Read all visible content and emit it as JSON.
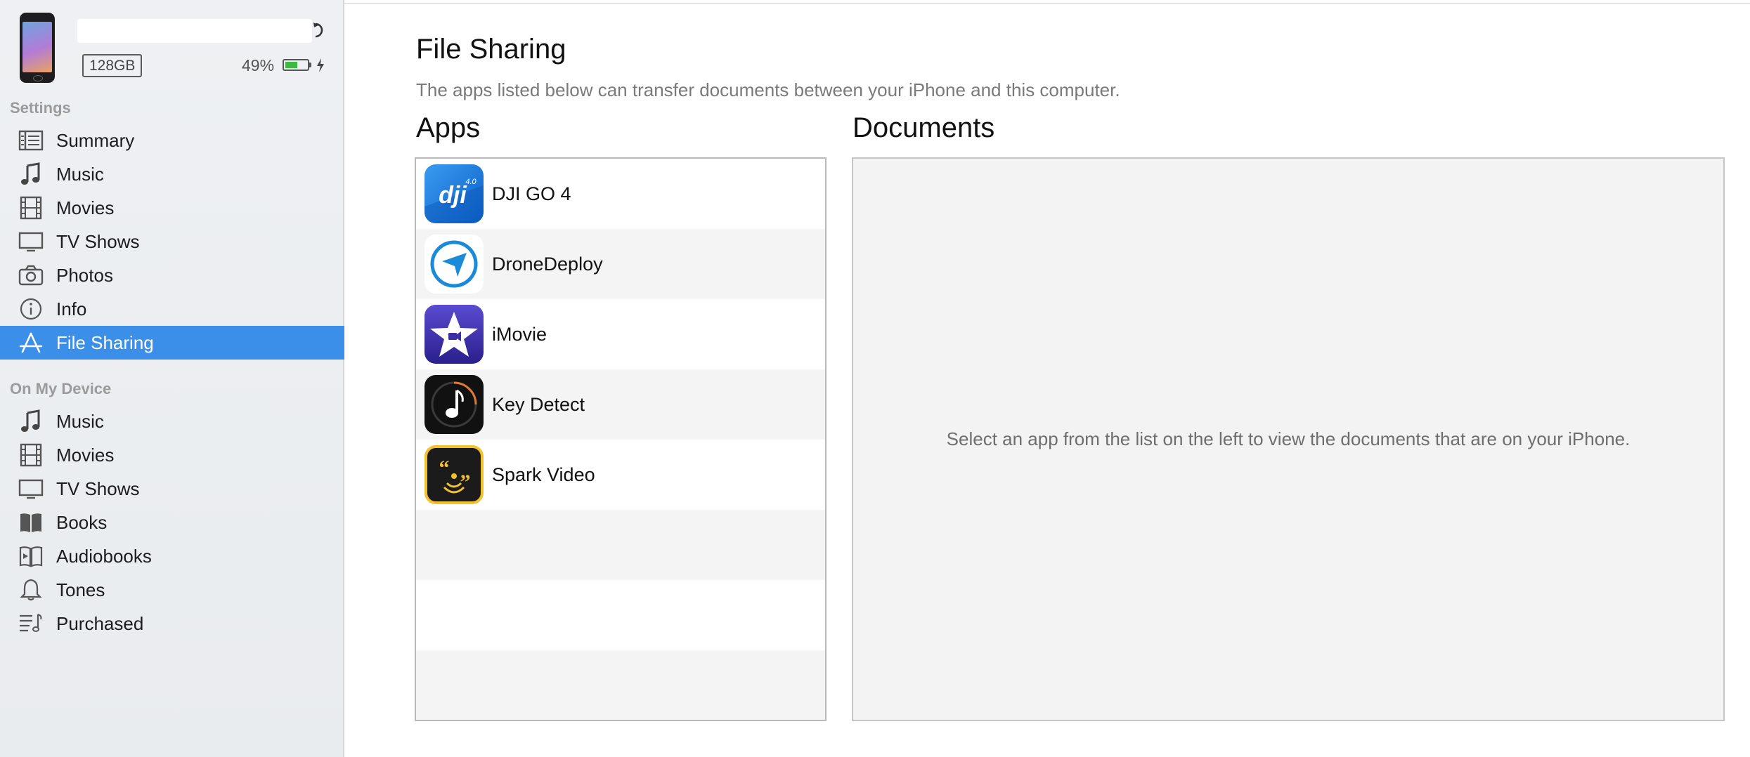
{
  "device": {
    "capacity": "128GB",
    "battery_percent": "49%",
    "battery_level": 0.49,
    "name_value": ""
  },
  "sidebar": {
    "settings_label": "Settings",
    "settings_items": [
      {
        "label": "Summary",
        "icon": "summary-icon"
      },
      {
        "label": "Music",
        "icon": "music-note-icon"
      },
      {
        "label": "Movies",
        "icon": "film-icon"
      },
      {
        "label": "TV Shows",
        "icon": "tv-icon"
      },
      {
        "label": "Photos",
        "icon": "camera-icon"
      },
      {
        "label": "Info",
        "icon": "info-icon"
      },
      {
        "label": "File Sharing",
        "icon": "app-store-icon",
        "selected": true
      }
    ],
    "device_label": "On My Device",
    "device_items": [
      {
        "label": "Music",
        "icon": "music-note-icon"
      },
      {
        "label": "Movies",
        "icon": "film-icon"
      },
      {
        "label": "TV Shows",
        "icon": "tv-icon"
      },
      {
        "label": "Books",
        "icon": "book-icon"
      },
      {
        "label": "Audiobooks",
        "icon": "audiobook-icon"
      },
      {
        "label": "Tones",
        "icon": "bell-icon"
      },
      {
        "label": "Purchased",
        "icon": "purchased-list-icon"
      }
    ]
  },
  "main": {
    "title": "File Sharing",
    "subtitle": "The apps listed below can transfer documents between your iPhone and this computer.",
    "apps_heading": "Apps",
    "documents_heading": "Documents",
    "apps": [
      {
        "name": "DJI GO 4",
        "icon": "dji-go-4-icon"
      },
      {
        "name": "DroneDeploy",
        "icon": "dronedeploy-icon"
      },
      {
        "name": "iMovie",
        "icon": "imovie-icon"
      },
      {
        "name": "Key Detect",
        "icon": "key-detect-icon"
      },
      {
        "name": "Spark Video",
        "icon": "spark-video-icon"
      }
    ],
    "documents_empty_message": "Select an app from the list on the left to view the documents that are on your iPhone."
  },
  "colors": {
    "selection": "#3b8fe8",
    "battery": "#3cb843",
    "sidebar_bg": "#eef0f3"
  }
}
